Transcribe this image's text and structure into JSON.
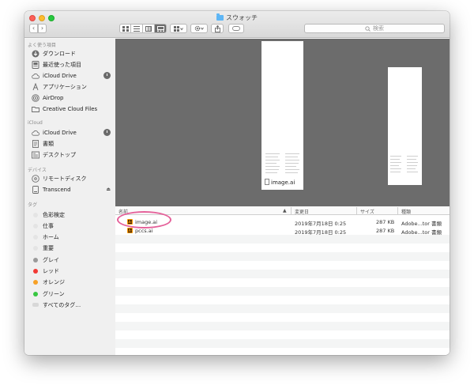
{
  "window": {
    "title": "スウォッチ"
  },
  "toolbar": {
    "back_icon": "‹",
    "forward_icon": "›",
    "search_placeholder": "検索"
  },
  "sidebar": {
    "sections": {
      "favorites": "よく使う項目",
      "icloud": "iCloud",
      "devices": "デバイス",
      "tags": "タグ"
    },
    "favorites": [
      {
        "label": "ダウンロード",
        "icon": "download-icon"
      },
      {
        "label": "最近使った項目",
        "icon": "recents-icon"
      },
      {
        "label": "iCloud Drive",
        "icon": "cloud-icon"
      },
      {
        "label": "アプリケーション",
        "icon": "applications-icon"
      },
      {
        "label": "AirDrop",
        "icon": "airdrop-icon"
      },
      {
        "label": "Creative Cloud Files",
        "icon": "folder-icon"
      }
    ],
    "icloud": [
      {
        "label": "iCloud Drive",
        "icon": "cloud-icon"
      },
      {
        "label": "書類",
        "icon": "documents-icon"
      },
      {
        "label": "デスクトップ",
        "icon": "desktop-icon"
      }
    ],
    "devices": [
      {
        "label": "リモートディスク",
        "icon": "disc-icon"
      },
      {
        "label": "Transcend",
        "icon": "drive-icon",
        "eject": "⏏"
      }
    ],
    "tags": [
      {
        "label": "色彩検定",
        "color": "#e4e4e4"
      },
      {
        "label": "仕事",
        "color": "#e4e4e4"
      },
      {
        "label": "ホーム",
        "color": "#e4e4e4"
      },
      {
        "label": "重要",
        "color": "#e4e4e4"
      },
      {
        "label": "グレイ",
        "color": "#9a9a9a"
      },
      {
        "label": "レッド",
        "color": "#f23a35"
      },
      {
        "label": "オレンジ",
        "color": "#f7a126"
      },
      {
        "label": "グリーン",
        "color": "#38c742"
      },
      {
        "label": "すべてのタグ…",
        "color": "#d8d8d8"
      }
    ]
  },
  "preview": {
    "label": "image.ai"
  },
  "list": {
    "columns": {
      "name": "名前",
      "date": "変更日",
      "size": "サイズ",
      "kind": "種類"
    },
    "sort_indicator": "▲",
    "rows": [
      {
        "name": "image.ai",
        "date": "2019年7月18日 0:25",
        "size": "287 KB",
        "kind": "Adobe...tor 書類"
      },
      {
        "name": "pccs.ai",
        "date": "2019年7月18日 0:25",
        "size": "287 KB",
        "kind": "Adobe...tor 書類"
      }
    ],
    "file_icon_text": "Ai"
  },
  "colors": {
    "annotation": "#e5619a",
    "preview_bg": "#6c6c6c",
    "illustrator_orange": "#ff9a00"
  }
}
